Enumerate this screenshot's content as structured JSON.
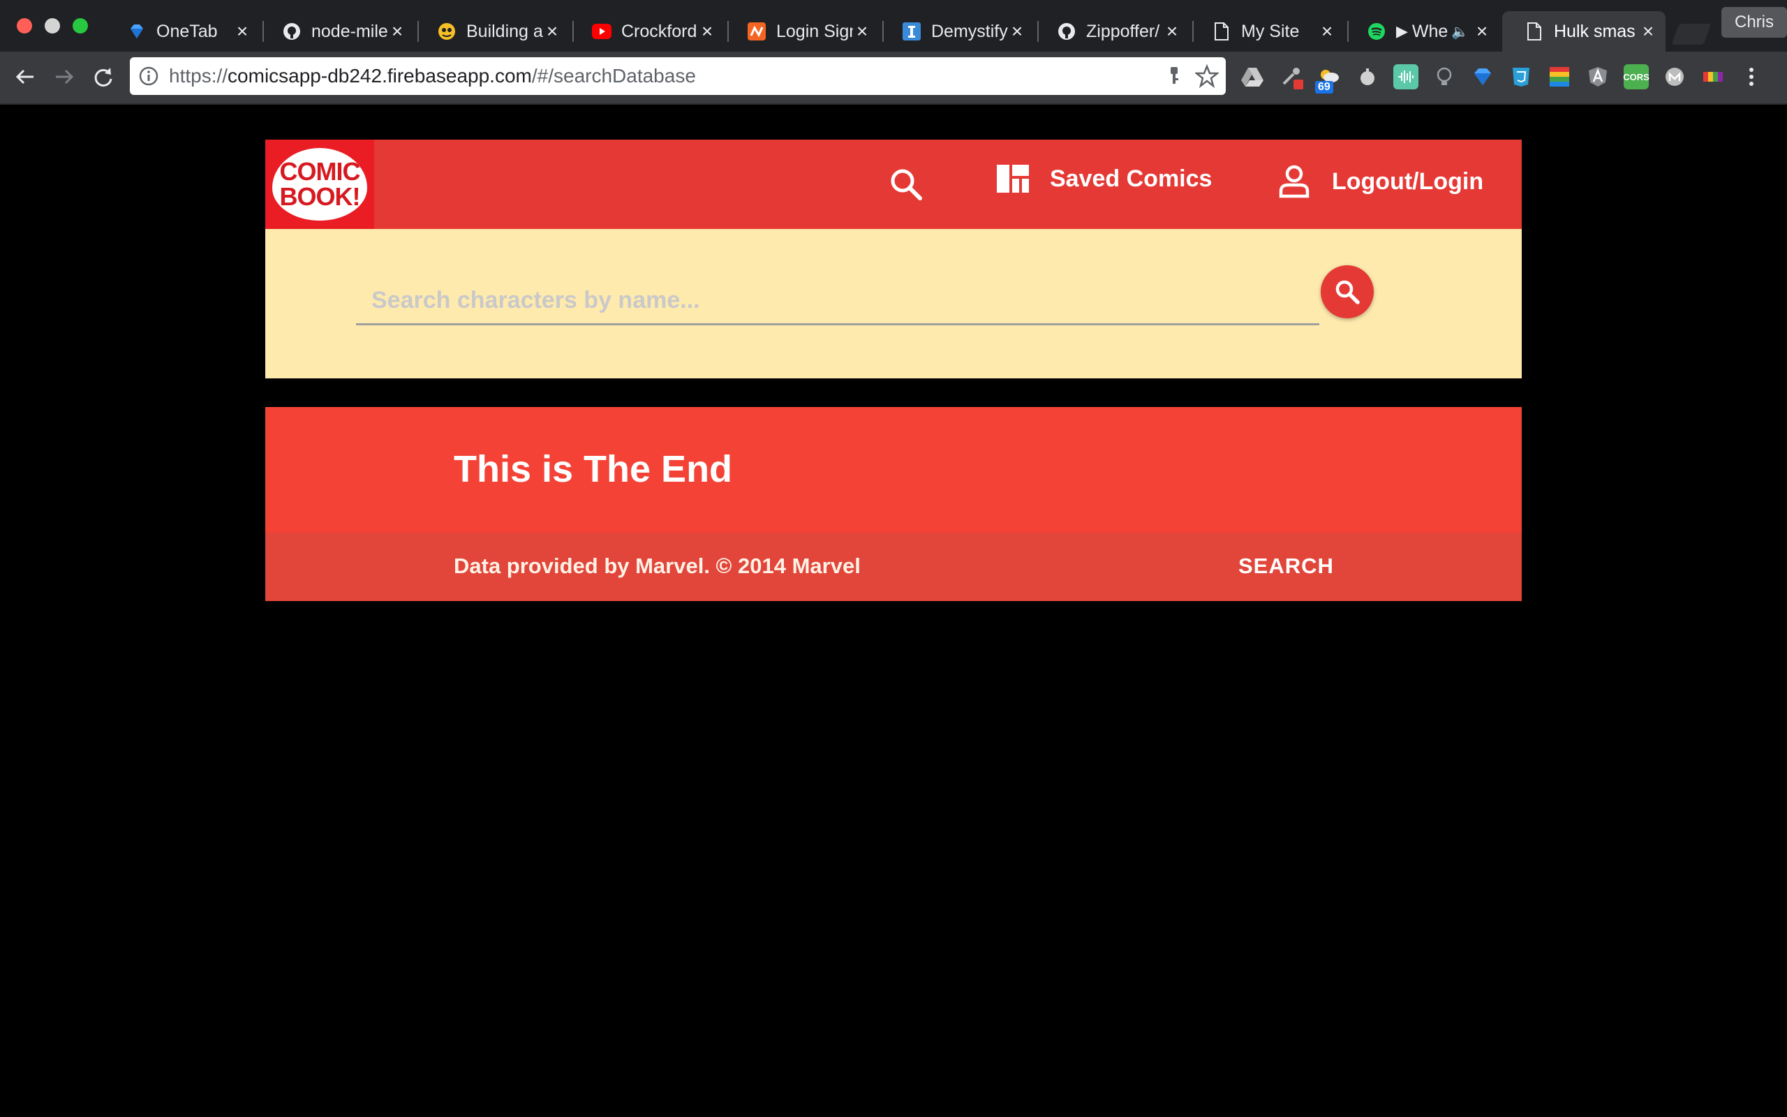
{
  "browser": {
    "tabs": [
      {
        "title": "OneTab",
        "icon": "diamond-icon"
      },
      {
        "title": "node-mile",
        "icon": "github-icon"
      },
      {
        "title": "Building a",
        "icon": "yellow-face-icon"
      },
      {
        "title": "Crockford",
        "icon": "youtube-icon"
      },
      {
        "title": "Login Sign",
        "icon": "squiggle-icon"
      },
      {
        "title": "Demystify",
        "icon": "i-icon"
      },
      {
        "title": "Zippoffer/",
        "icon": "github-icon"
      },
      {
        "title": "My Site",
        "icon": "page-icon"
      },
      {
        "title": "Whe",
        "icon": "spotify-icon"
      },
      {
        "title": "Hulk smas",
        "icon": "page-icon"
      }
    ],
    "profile_name": "Chris",
    "url_scheme": "https://",
    "url_host": "comicsapp-db242.firebaseapp.com",
    "url_path": "/#/searchDatabase",
    "extension_badge": "69"
  },
  "app": {
    "logo_line1": "COMIC",
    "logo_line2": "BOOK!",
    "nav_saved_label": "Saved Comics",
    "nav_login_label": "Logout/Login",
    "search_placeholder": "Search characters by name...",
    "footer_title": "This is The End",
    "footer_credit": "Data provided by Marvel. © 2014 Marvel",
    "footer_link": "SEARCH",
    "colors": {
      "header_red": "#e53935",
      "panel_cream": "#ffeaad",
      "footer_red": "#f44336"
    }
  }
}
